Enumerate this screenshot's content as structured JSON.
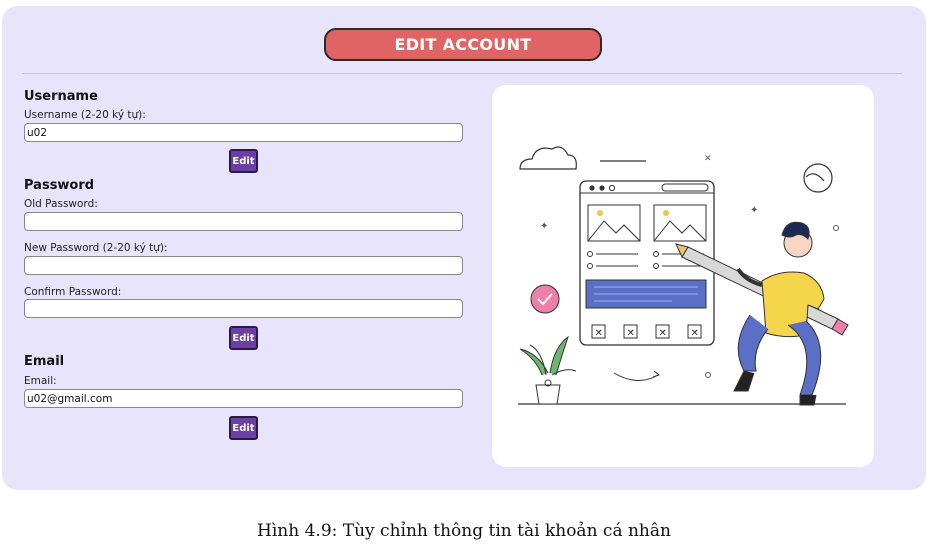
{
  "header": {
    "title": "EDIT ACCOUNT"
  },
  "username_section": {
    "heading": "Username",
    "label": "Username (2-20 ký tự):",
    "value": "u02",
    "button": "Edit"
  },
  "password_section": {
    "heading": "Password",
    "old_label": "Old Password:",
    "old_value": "",
    "new_label": "New Password (2-20 ký tự):",
    "new_value": "",
    "confirm_label": "Confirm Password:",
    "confirm_value": "",
    "button": "Edit"
  },
  "email_section": {
    "heading": "Email",
    "label": "Email:",
    "value": "u02@gmail.com",
    "button": "Edit"
  },
  "illustration": {
    "icon": "person-editing-webpage-illustration"
  },
  "caption": "Hình 4.9: Tùy chỉnh thông tin tài khoản cá nhân",
  "colors": {
    "panel_bg": "#e8e4fb",
    "title_button": "#e06464",
    "edit_button": "#6a3fa6"
  }
}
